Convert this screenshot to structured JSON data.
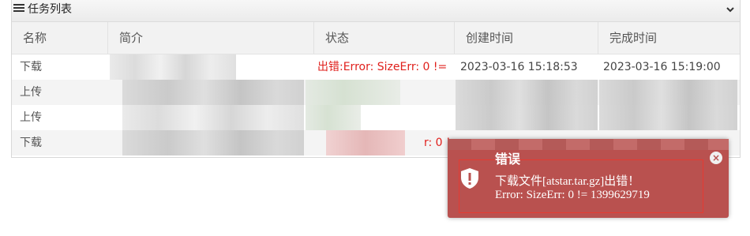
{
  "panel": {
    "title": "任务列表"
  },
  "table": {
    "headers": [
      "名称",
      "简介",
      "状态",
      "创建时间",
      "完成时间"
    ],
    "rows": [
      {
        "name": "下载",
        "status": "出错:Error: SizeErr: 0 !=",
        "created": "2023-03-16 15:18:53",
        "finished": "2023-03-16 15:19:00"
      },
      {
        "name": "上传",
        "status": "",
        "created": "",
        "finished": ""
      },
      {
        "name": "上传",
        "status": "",
        "created": "",
        "finished": ""
      },
      {
        "name": "下载",
        "status": "r: 0 !=",
        "created": "",
        "finished": ""
      }
    ]
  },
  "toast": {
    "title": "错误",
    "line1": "下载文件[atstar.tar.gz]出错！",
    "line2": "Error: SizeErr: 0 != 1399629719",
    "close": "×"
  },
  "colors": {
    "error_text": "#e0201c",
    "toast_bg": "#b9514f",
    "toast_border": "#e63a32"
  }
}
